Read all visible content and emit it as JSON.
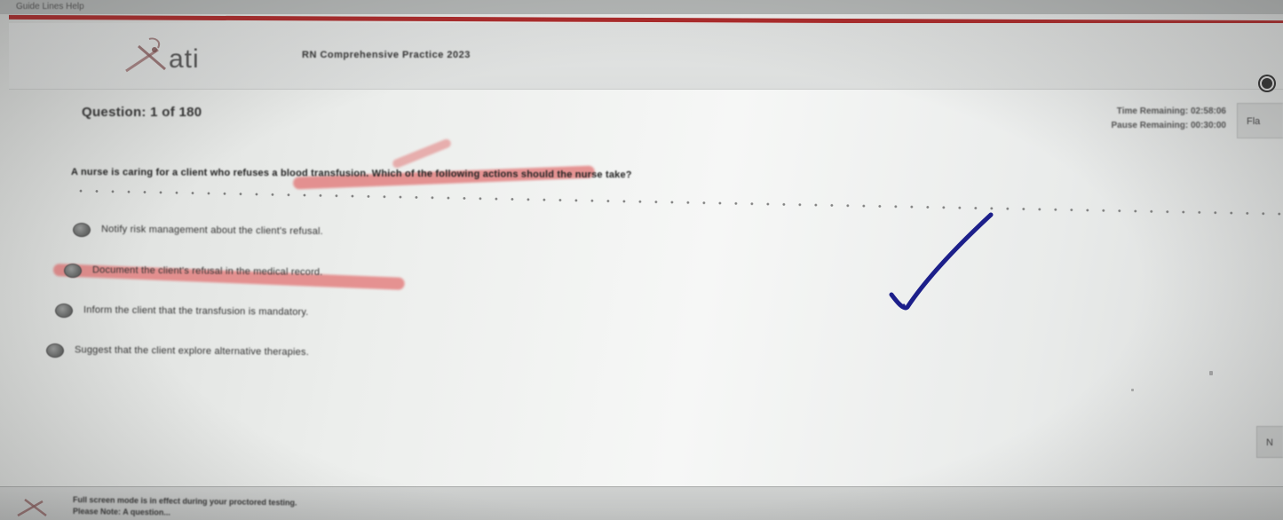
{
  "app": {
    "menubar_text": "Guide Lines  Help"
  },
  "header": {
    "logo_text": "ati",
    "exam_title": "RN Comprehensive Practice 2023"
  },
  "question": {
    "counter": "Question: 1 of 180",
    "time_remaining": "Time Remaining: 02:58:06",
    "pause_remaining": "Pause Remaining: 00:30:00",
    "flag_label": "Fla",
    "stem": "A nurse is caring for a client who refuses a blood transfusion. Which of the following actions should the nurse take?",
    "options": [
      {
        "text": "Notify risk management about the client's refusal."
      },
      {
        "text": "Document the client's refusal in the medical record."
      },
      {
        "text": "Inform the client that the transfusion is mandatory."
      },
      {
        "text": "Suggest that the client explore alternative therapies."
      }
    ],
    "next_label": "N"
  },
  "footer": {
    "note_line_1": "Full screen mode is in effect during your proctored testing.",
    "note_line_2": "Please Note: A question..."
  },
  "colors": {
    "highlighter": "#e06e6e",
    "checkmark_ink": "#1c1f8a",
    "brand_rule": "#b02a2a"
  },
  "icons": {
    "logo": "ati-logo-icon",
    "settings": "settings-icon",
    "checkmark": "handwritten-checkmark-icon"
  }
}
